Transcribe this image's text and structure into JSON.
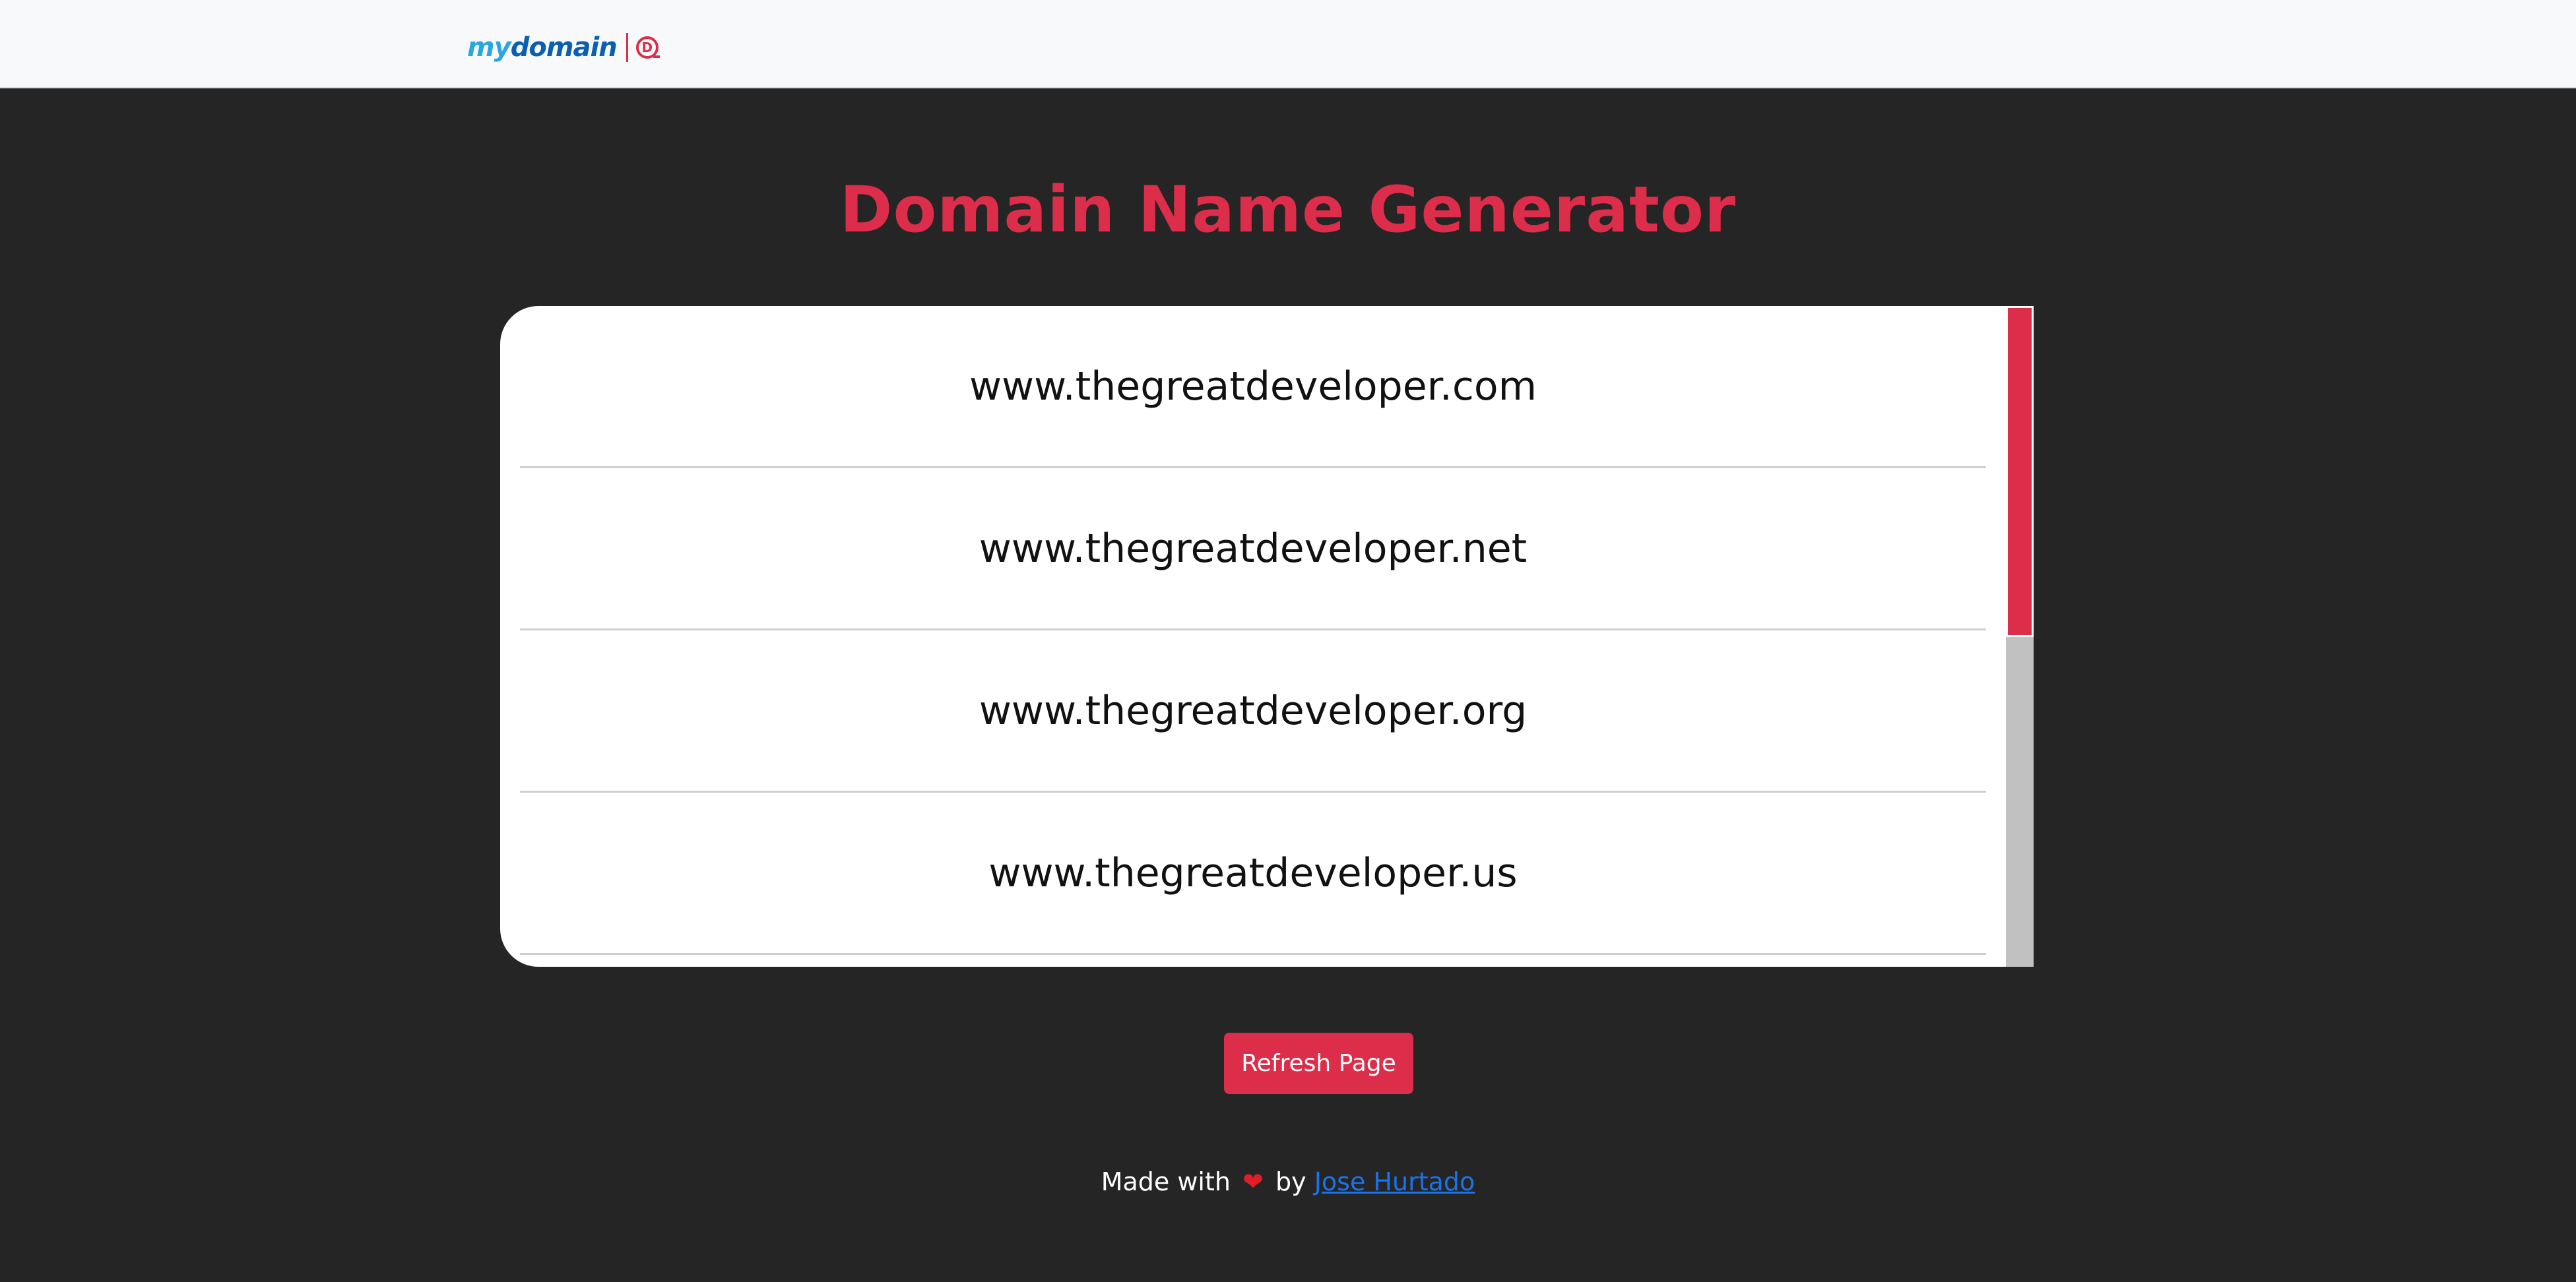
{
  "navbar": {
    "brand_my": "my",
    "brand_domain": "domain",
    "badge_letter": "D"
  },
  "page": {
    "title": "Domain Name Generator"
  },
  "domains": [
    "www.thegreatdeveloper.com",
    "www.thegreatdeveloper.net",
    "www.thegreatdeveloper.org",
    "www.thegreatdeveloper.us"
  ],
  "actions": {
    "refresh_label": "Refresh Page"
  },
  "footer": {
    "made_with": "Made with",
    "heart": "❤",
    "by": "by",
    "author": "Jose Hurtado"
  },
  "colors": {
    "accent": "#dc2d4a",
    "background": "#252525",
    "navbar": "#f8f9fa",
    "link": "#1a73e8"
  }
}
